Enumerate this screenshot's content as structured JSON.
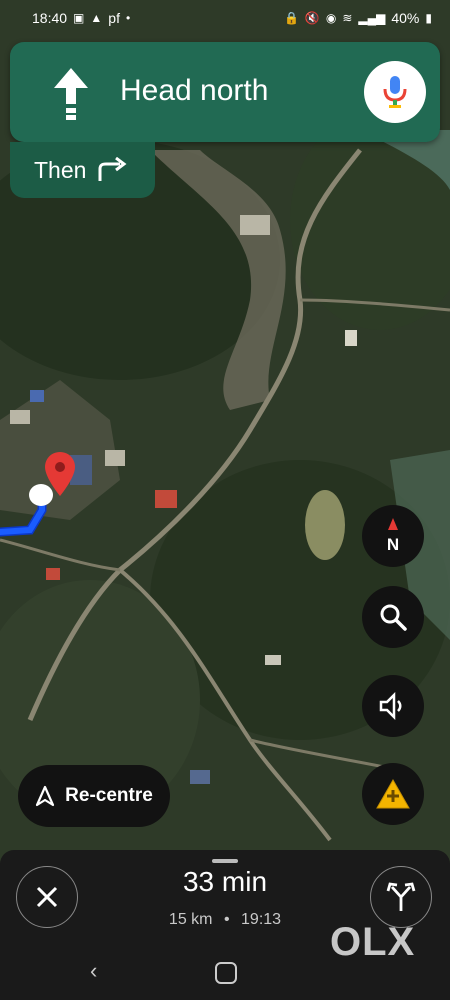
{
  "status_bar": {
    "time": "18:40",
    "left_text": "pf",
    "right_text": "40%"
  },
  "navigation": {
    "instruction": "Head north",
    "then_label": "Then"
  },
  "buttons": {
    "recenter_label": "Re-centre"
  },
  "trip": {
    "eta_value": "33 min",
    "distance": "15 km",
    "arrival": "19:13",
    "separator": "•"
  },
  "watermark": {
    "text": "OLX"
  },
  "icons": {
    "compass": "compass-north-icon",
    "search": "search-icon",
    "volume": "volume-icon",
    "report": "report-incident-icon",
    "close": "close-icon",
    "alternate_routes": "alternate-routes-icon",
    "mic": "mic-icon"
  },
  "colors": {
    "nav_green": "#216a53",
    "route_blue": "#1a5cff",
    "pin_red": "#e53935"
  }
}
